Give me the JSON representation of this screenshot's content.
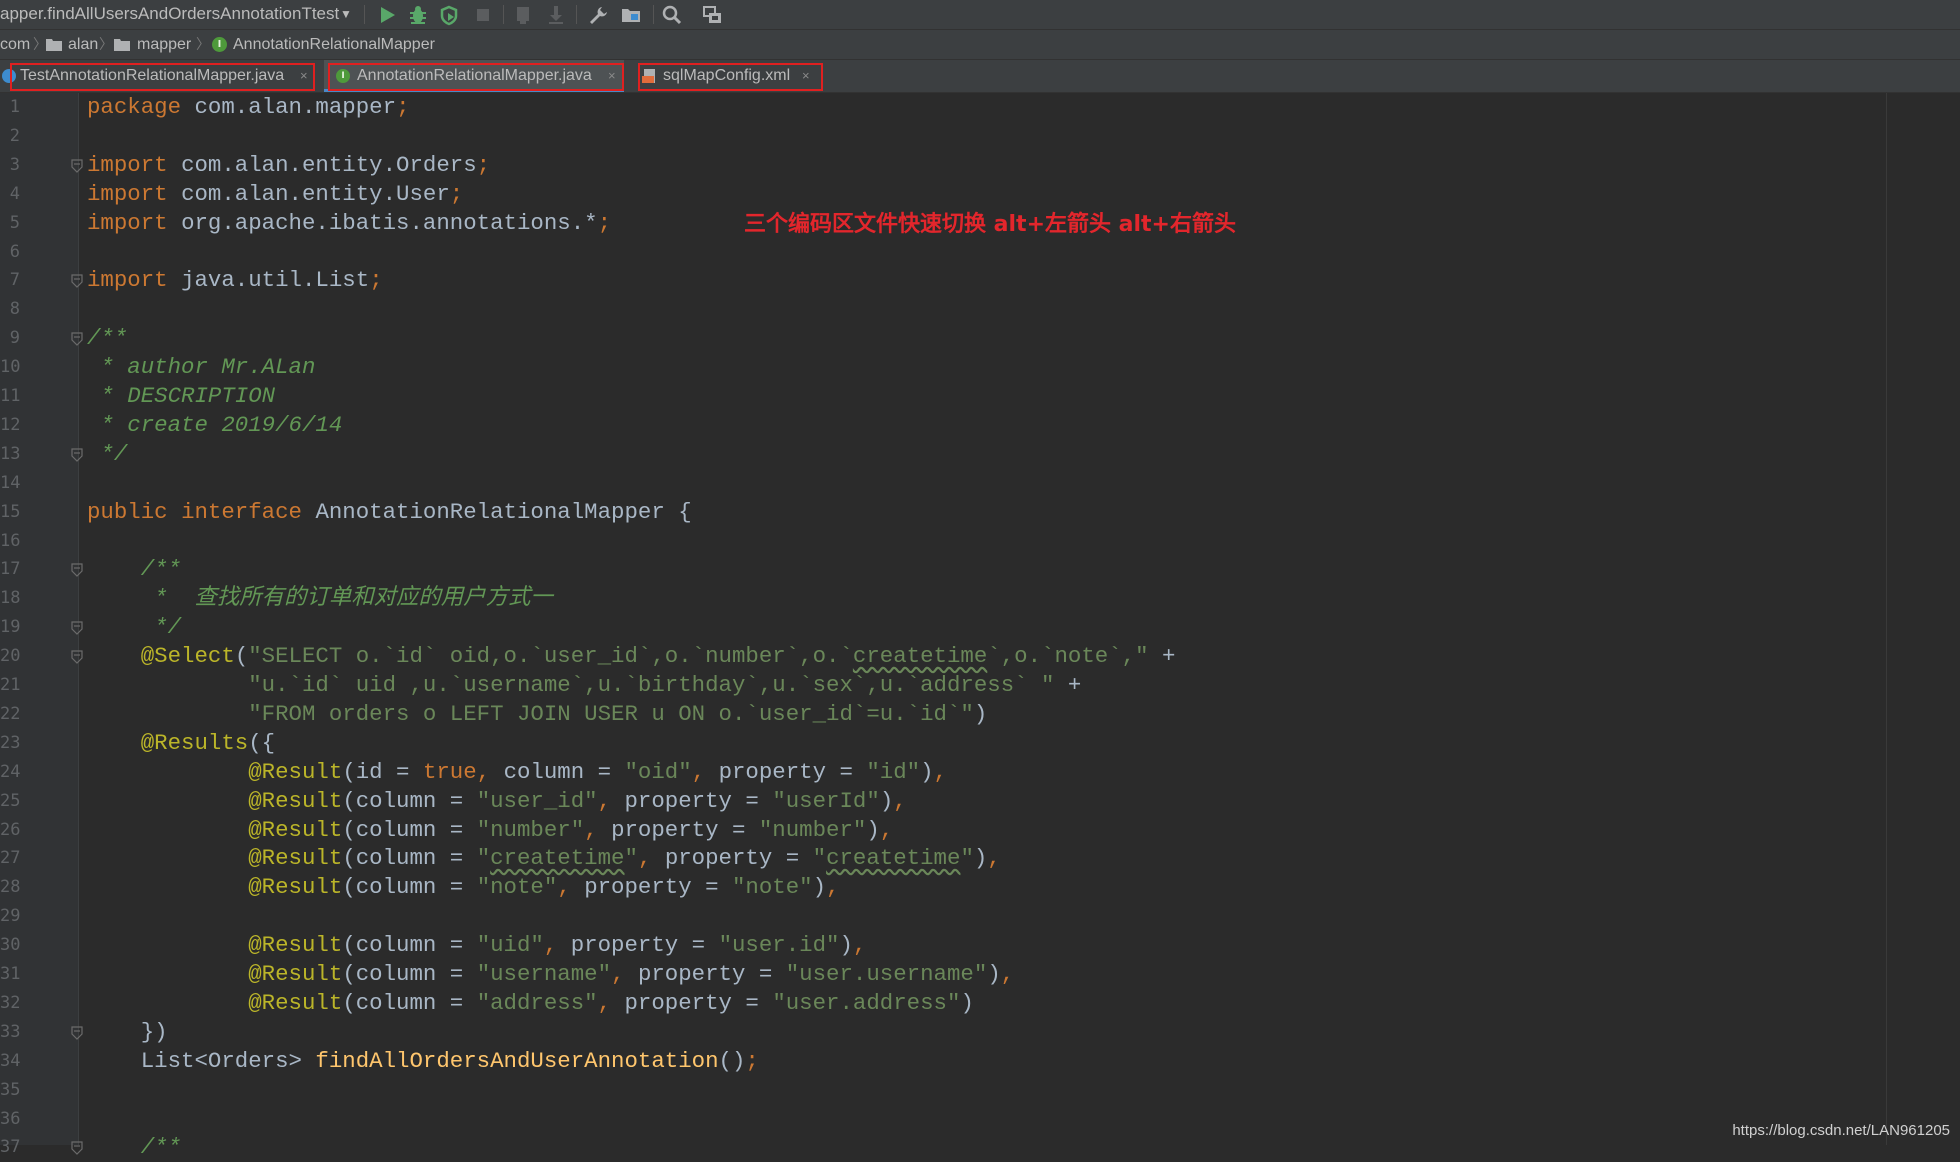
{
  "toolbar": {
    "run_config": "apper.findAllUsersAndOrdersAnnotationTtest",
    "icons": [
      "run-icon",
      "debug-icon",
      "coverage-icon",
      "stop-icon",
      "build-icon",
      "download-icon",
      "wrench-icon",
      "project-structure-icon",
      "search-icon",
      "sdk-icon"
    ]
  },
  "breadcrumb": {
    "items": [
      "com",
      "alan",
      "mapper",
      "AnnotationRelationalMapper"
    ],
    "interface_badge": "I"
  },
  "tabs": [
    {
      "label": "TestAnnotationRelationalMapper.java",
      "close": "×"
    },
    {
      "label": "AnnotationRelationalMapper.java",
      "close": "×",
      "badge": "I"
    },
    {
      "label": "sqlMapConfig.xml",
      "close": "×"
    }
  ],
  "annotation_note": "三个编码区文件快速切换 alt+左箭头  alt+右箭头",
  "code_lines": [
    [
      {
        "t": "package ",
        "c": "kw"
      },
      {
        "t": "com.alan.mapper",
        "c": "plain"
      },
      {
        "t": ";",
        "c": "kw"
      }
    ],
    [],
    [
      {
        "t": "import ",
        "c": "kw"
      },
      {
        "t": "com.alan.entity.Orders",
        "c": "plain"
      },
      {
        "t": ";",
        "c": "kw"
      }
    ],
    [
      {
        "t": "import ",
        "c": "kw"
      },
      {
        "t": "com.alan.entity.User",
        "c": "plain"
      },
      {
        "t": ";",
        "c": "kw"
      }
    ],
    [
      {
        "t": "import ",
        "c": "kw"
      },
      {
        "t": "org.apache.ibatis.annotations.*",
        "c": "plain"
      },
      {
        "t": ";",
        "c": "kw"
      }
    ],
    [],
    [
      {
        "t": "import ",
        "c": "kw"
      },
      {
        "t": "java.util.List",
        "c": "plain"
      },
      {
        "t": ";",
        "c": "kw"
      }
    ],
    [],
    [
      {
        "t": "/**",
        "c": "cm"
      }
    ],
    [
      {
        "t": " * author Mr.ALan",
        "c": "cm"
      }
    ],
    [
      {
        "t": " * DESCRIPTION",
        "c": "cm"
      }
    ],
    [
      {
        "t": " * create 2019/6/14",
        "c": "cm"
      }
    ],
    [
      {
        "t": " */",
        "c": "cm"
      }
    ],
    [],
    [
      {
        "t": "public ",
        "c": "kw"
      },
      {
        "t": "interface ",
        "c": "kw"
      },
      {
        "t": "AnnotationRelationalMapper {",
        "c": "plain"
      }
    ],
    [],
    [
      {
        "t": "    /**",
        "c": "cm"
      }
    ],
    [
      {
        "t": "     *  查找所有的订单和对应的用户方式一",
        "c": "cm"
      }
    ],
    [
      {
        "t": "     */",
        "c": "cm"
      }
    ],
    [
      {
        "t": "    ",
        "c": "plain"
      },
      {
        "t": "@Select",
        "c": "ann"
      },
      {
        "t": "(",
        "c": "plain"
      },
      {
        "t": "\"SELECT o.`id` oid,o.`user_id`,o.`number`,o.`",
        "c": "str"
      },
      {
        "t": "createtime",
        "c": "str squig"
      },
      {
        "t": "`,o.`note`,\"",
        "c": "str"
      },
      {
        "t": " +",
        "c": "plain"
      }
    ],
    [
      {
        "t": "            ",
        "c": "plain"
      },
      {
        "t": "\"u.`id` uid ,u.`username`,u.`birthday`,u.`sex`,u.`address` \"",
        "c": "str"
      },
      {
        "t": " +",
        "c": "plain"
      }
    ],
    [
      {
        "t": "            ",
        "c": "plain"
      },
      {
        "t": "\"FROM orders o LEFT JOIN USER u ON o.`user_id`=u.`id`\"",
        "c": "str"
      },
      {
        "t": ")",
        "c": "plain"
      }
    ],
    [
      {
        "t": "    ",
        "c": "plain"
      },
      {
        "t": "@Results",
        "c": "ann"
      },
      {
        "t": "({",
        "c": "plain"
      }
    ],
    [
      {
        "t": "            ",
        "c": "plain"
      },
      {
        "t": "@Result",
        "c": "ann"
      },
      {
        "t": "(id = ",
        "c": "plain"
      },
      {
        "t": "true",
        "c": "kw"
      },
      {
        "t": ", ",
        "c": "kw"
      },
      {
        "t": "column = ",
        "c": "plain"
      },
      {
        "t": "\"oid\"",
        "c": "str"
      },
      {
        "t": ", ",
        "c": "kw"
      },
      {
        "t": "property = ",
        "c": "plain"
      },
      {
        "t": "\"id\"",
        "c": "str"
      },
      {
        "t": ")",
        "c": "plain"
      },
      {
        "t": ",",
        "c": "kw"
      }
    ],
    [
      {
        "t": "            ",
        "c": "plain"
      },
      {
        "t": "@Result",
        "c": "ann"
      },
      {
        "t": "(column = ",
        "c": "plain"
      },
      {
        "t": "\"user_id\"",
        "c": "str"
      },
      {
        "t": ", ",
        "c": "kw"
      },
      {
        "t": "property = ",
        "c": "plain"
      },
      {
        "t": "\"userId\"",
        "c": "str"
      },
      {
        "t": ")",
        "c": "plain"
      },
      {
        "t": ",",
        "c": "kw"
      }
    ],
    [
      {
        "t": "            ",
        "c": "plain"
      },
      {
        "t": "@Result",
        "c": "ann"
      },
      {
        "t": "(column = ",
        "c": "plain"
      },
      {
        "t": "\"number\"",
        "c": "str"
      },
      {
        "t": ", ",
        "c": "kw"
      },
      {
        "t": "property = ",
        "c": "plain"
      },
      {
        "t": "\"number\"",
        "c": "str"
      },
      {
        "t": ")",
        "c": "plain"
      },
      {
        "t": ",",
        "c": "kw"
      }
    ],
    [
      {
        "t": "            ",
        "c": "plain"
      },
      {
        "t": "@Result",
        "c": "ann"
      },
      {
        "t": "(column = ",
        "c": "plain"
      },
      {
        "t": "\"",
        "c": "str"
      },
      {
        "t": "createtime",
        "c": "str squig"
      },
      {
        "t": "\"",
        "c": "str"
      },
      {
        "t": ", ",
        "c": "kw"
      },
      {
        "t": "property = ",
        "c": "plain"
      },
      {
        "t": "\"",
        "c": "str"
      },
      {
        "t": "createtime",
        "c": "str squig"
      },
      {
        "t": "\"",
        "c": "str"
      },
      {
        "t": ")",
        "c": "plain"
      },
      {
        "t": ",",
        "c": "kw"
      }
    ],
    [
      {
        "t": "            ",
        "c": "plain"
      },
      {
        "t": "@Result",
        "c": "ann"
      },
      {
        "t": "(column = ",
        "c": "plain"
      },
      {
        "t": "\"note\"",
        "c": "str"
      },
      {
        "t": ", ",
        "c": "kw"
      },
      {
        "t": "property = ",
        "c": "plain"
      },
      {
        "t": "\"note\"",
        "c": "str"
      },
      {
        "t": ")",
        "c": "plain"
      },
      {
        "t": ",",
        "c": "kw"
      }
    ],
    [],
    [
      {
        "t": "            ",
        "c": "plain"
      },
      {
        "t": "@Result",
        "c": "ann"
      },
      {
        "t": "(column = ",
        "c": "plain"
      },
      {
        "t": "\"uid\"",
        "c": "str"
      },
      {
        "t": ", ",
        "c": "kw"
      },
      {
        "t": "property = ",
        "c": "plain"
      },
      {
        "t": "\"user.id\"",
        "c": "str"
      },
      {
        "t": ")",
        "c": "plain"
      },
      {
        "t": ",",
        "c": "kw"
      }
    ],
    [
      {
        "t": "            ",
        "c": "plain"
      },
      {
        "t": "@Result",
        "c": "ann"
      },
      {
        "t": "(column = ",
        "c": "plain"
      },
      {
        "t": "\"username\"",
        "c": "str"
      },
      {
        "t": ", ",
        "c": "kw"
      },
      {
        "t": "property = ",
        "c": "plain"
      },
      {
        "t": "\"user.username\"",
        "c": "str"
      },
      {
        "t": ")",
        "c": "plain"
      },
      {
        "t": ",",
        "c": "kw"
      }
    ],
    [
      {
        "t": "            ",
        "c": "plain"
      },
      {
        "t": "@Result",
        "c": "ann"
      },
      {
        "t": "(column = ",
        "c": "plain"
      },
      {
        "t": "\"address\"",
        "c": "str"
      },
      {
        "t": ", ",
        "c": "kw"
      },
      {
        "t": "property = ",
        "c": "plain"
      },
      {
        "t": "\"user.address\"",
        "c": "str"
      },
      {
        "t": ")",
        "c": "plain"
      }
    ],
    [
      {
        "t": "    })",
        "c": "plain"
      }
    ],
    [
      {
        "t": "    List<Orders> ",
        "c": "plain"
      },
      {
        "t": "findAllOrdersAndUserAnnotation",
        "c": "fn"
      },
      {
        "t": "()",
        "c": "plain"
      },
      {
        "t": ";",
        "c": "kw"
      }
    ],
    [],
    [],
    [
      {
        "t": "    /**",
        "c": "cm"
      }
    ]
  ],
  "line_numbers": [
    "1",
    "2",
    "3",
    "4",
    "5",
    "6",
    "7",
    "8",
    "9",
    "10",
    "11",
    "12",
    "13",
    "14",
    "15",
    "16",
    "17",
    "18",
    "19",
    "20",
    "21",
    "22",
    "23",
    "24",
    "25",
    "26",
    "27",
    "28",
    "29",
    "30",
    "31",
    "32",
    "33",
    "34",
    "35",
    "36",
    "37"
  ],
  "fold_lines": [
    3,
    7,
    9,
    13,
    17,
    19,
    20,
    33,
    37
  ],
  "watermark": "https://blog.csdn.net/LAN961205",
  "colors": {
    "keyword": "#cc7832",
    "string": "#6a8759",
    "annotation": "#bbb529",
    "comment": "#629755",
    "function": "#ffc66d",
    "plain": "#a9b7c6",
    "highlight_box": "#e02020",
    "note": "#e3262c"
  }
}
